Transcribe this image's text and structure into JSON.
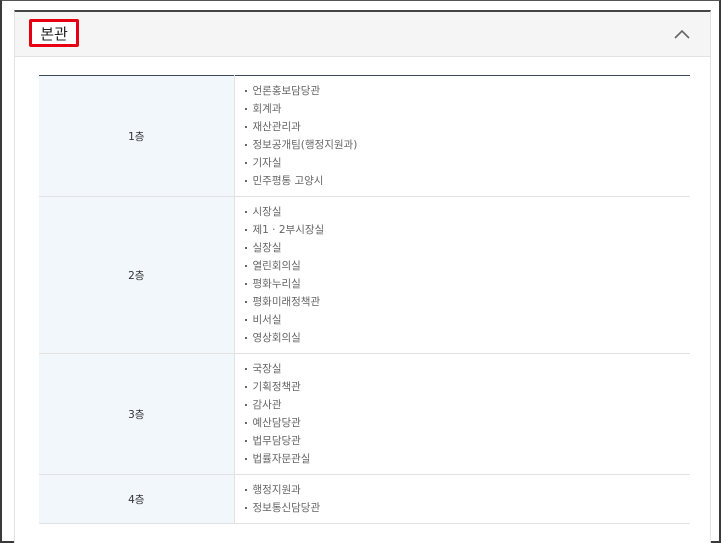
{
  "section": {
    "title": "본관"
  },
  "floors": [
    {
      "name": "1층",
      "rooms": [
        "언론홍보담당관",
        "회계과",
        "재산관리과",
        "정보공개팀(행정지원과)",
        "기자실",
        "민주평통 고양시"
      ]
    },
    {
      "name": "2층",
      "rooms": [
        "시장실",
        "제1 · 2부시장실",
        "실장실",
        "열린회의실",
        "평화누리실",
        "평화미래정책관",
        "비서실",
        "영상회의실"
      ]
    },
    {
      "name": "3층",
      "rooms": [
        "국장실",
        "기획정책관",
        "감사관",
        "예산담당관",
        "법무담당관",
        "법률자문관실"
      ]
    },
    {
      "name": "4층",
      "rooms": [
        "행정지원과",
        "정보통신담당관"
      ]
    }
  ],
  "icons": {
    "toggle": "chevron-up-icon"
  },
  "colors": {
    "highlight": "#e60012",
    "floor_cell_bg": "#f2f7fb",
    "table_top_border": "#3b4a5a"
  }
}
